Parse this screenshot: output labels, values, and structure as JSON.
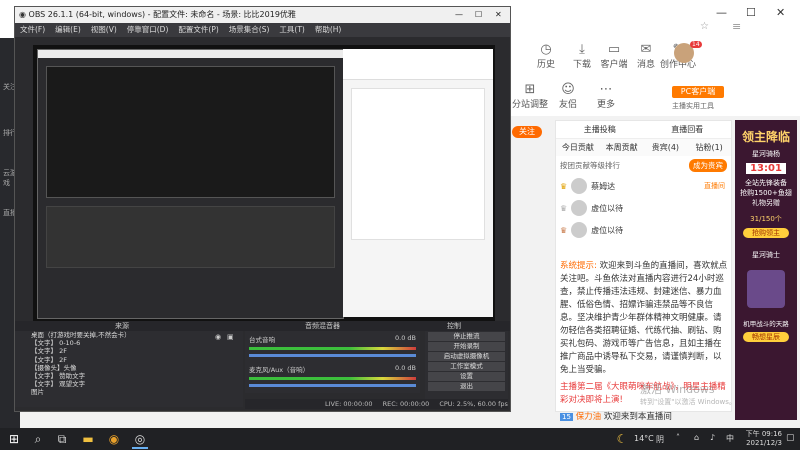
{
  "browser": {
    "sidebar_items": [
      "关注",
      "排行",
      "云游戏",
      "直播"
    ],
    "header_icons": [
      "历史",
      "下载",
      "客户端",
      "消息",
      "创作中心"
    ],
    "user_badge": "14",
    "pc_client": "PC客户端",
    "pc_client_sub": "主播实用工具",
    "row_icons": [
      "分站调整",
      "友侣",
      "更多"
    ],
    "follow": "关注",
    "panel_tabs": [
      "主播投稿",
      "直播回看"
    ],
    "rank_tabs": [
      "今日贡献",
      "本周贡献",
      "贵宾(4)",
      "钻粉(1)"
    ],
    "rank_title": "按团贡献等级排行",
    "send_btn": "成为贵宾",
    "rank_users": [
      {
        "name": "蔡姆达",
        "tag": "直播间"
      },
      {
        "name": "虚位以待"
      },
      {
        "name": "虚位以待"
      }
    ],
    "system_msg_label": "系统提示:",
    "system_msg": "欢迎来到斗鱼的直播间，喜欢就点关注吧。斗鱼依法对直播内容进行24小时巡查，禁止传播违法违规、封建迷信、暴力血腥、低俗色情、招嫖诈骗违禁品等不良信息。坚决维护青少年群体精神文明健康。请勿轻信各类招聘征婚、代练代抽、刷钻、购买礼包码、游戏币等广告信息，且如主播在推广商品中诱导私下交易，请谨慎判断，以免上当受骗。",
    "announce": "主播第二届《大眼萌咪车航战》，明星主播精彩对决即将上演!",
    "announce_highlight": "明星主播精彩对决即将上演!",
    "user_msg_name": "保力油",
    "user_msg_text": "欢迎来到本直播间",
    "user_msg_level": "15",
    "ad_title": "领主降临",
    "ad_sub": "星河骑杨",
    "ad_time": "13:01",
    "ad_lines": [
      "全站先锋装备",
      "抢购1500+鱼翅",
      "礼物另赠"
    ],
    "ad_price": "31/150个",
    "ad_cta": "抢购领主",
    "ad2_title": "星河骑士",
    "ad2_sub": "机甲战斗的天路",
    "ad2_cta": "畅想星辰"
  },
  "obs": {
    "title": "OBS 26.1.1 (64-bit, windows) - 配置文件: 未命名 - 场景: 比比2019优雅",
    "menu": [
      "文件(F)",
      "编辑(E)",
      "视图(V)",
      "停靠窗口(D)",
      "配置文件(P)",
      "场景集合(S)",
      "工具(T)",
      "帮助(H)"
    ],
    "panels": {
      "sources": "来源",
      "mixer": "音频混音器",
      "controls": "控制"
    },
    "sources": [
      "桌面（打游戏时要关掉,不然会卡）",
      "【文字】 0-10-6",
      "【文字】 2F",
      "【文字】 2F",
      "【摄像头】头像",
      "【文字】 赞助文字",
      "【文字】 观望文字",
      "图片"
    ],
    "mixer_tracks": [
      {
        "name": "台式音响",
        "level": "0.0 dB"
      },
      {
        "name": "麦克风/Aux（音响）",
        "level": "0.0 dB"
      }
    ],
    "controls": [
      "停止推流",
      "开始录制",
      "启动虚拟摄像机",
      "工作室模式",
      "设置",
      "退出"
    ],
    "status": {
      "live": "LIVE: 00:00:00",
      "rec": "REC: 00:00:00",
      "cpu": "CPU: 2.5%, 60.00 fps"
    }
  },
  "watermark": {
    "line1": "激活 Windows",
    "line2": "转到\"设置\"以激活 Windows。"
  },
  "taskbar": {
    "weather": "14°C",
    "weather_desc": "阴",
    "time": "下午 09:16",
    "date": "2021/12/3"
  }
}
